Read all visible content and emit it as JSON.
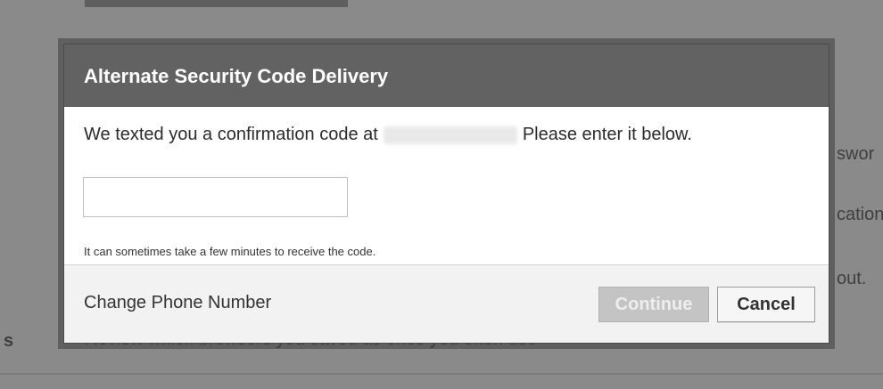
{
  "background": {
    "right_fragments": [
      "swor",
      "cation",
      "out."
    ],
    "left_fragment": "s",
    "bottom_text": "Review which browsers you saved as ones you often use"
  },
  "dialog": {
    "title": "Alternate Security Code Delivery",
    "message_prefix": "We texted you a confirmation code at",
    "message_suffix": "Please enter it below.",
    "code_input_value": "",
    "hint": "It can sometimes take a few minutes to receive the code.",
    "change_phone_label": "Change Phone Number",
    "continue_label": "Continue",
    "cancel_label": "Cancel"
  },
  "colors": {
    "header_bg": "#626262",
    "continue_disabled_bg": "#c4c4c4"
  }
}
